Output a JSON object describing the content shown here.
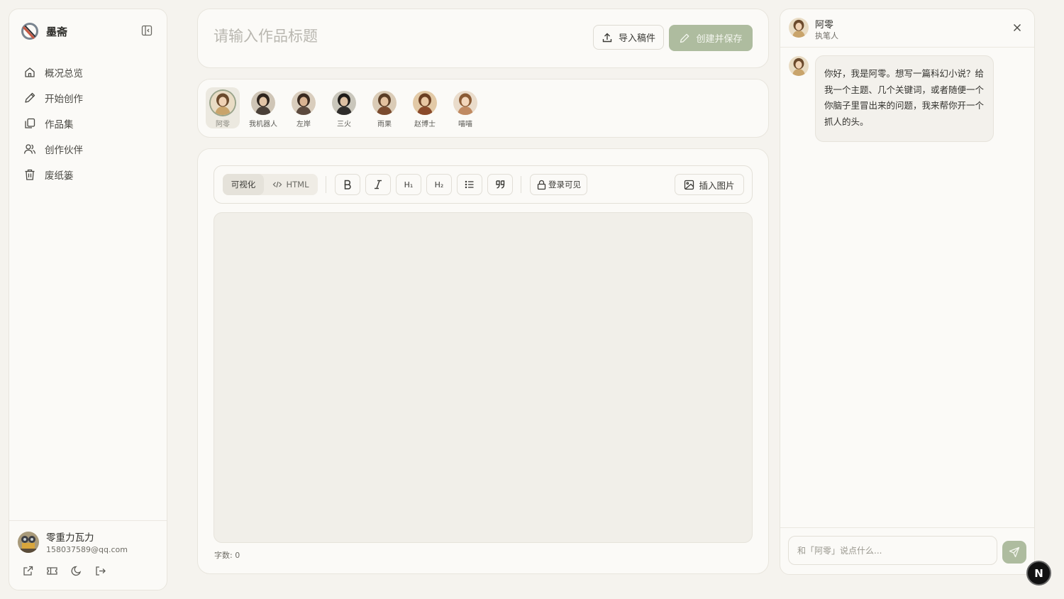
{
  "app": {
    "name": "墨斋",
    "logo_icon": "mozhai-logo-icon",
    "collapse_icon": "sidebar-collapse-icon"
  },
  "nav": [
    {
      "label": "概况总览",
      "icon": "home-icon"
    },
    {
      "label": "开始创作",
      "icon": "pen-icon"
    },
    {
      "label": "作品集",
      "icon": "copy-icon"
    },
    {
      "label": "创作伙伴",
      "icon": "users-icon"
    },
    {
      "label": "废纸篓",
      "icon": "trash-icon"
    }
  ],
  "user": {
    "name": "零重力瓦力",
    "email": "158037589@qq.com"
  },
  "footer_icons": [
    "external-link-icon",
    "ticket-icon",
    "theme-toggle-icon",
    "logout-icon"
  ],
  "title_bar": {
    "placeholder": "请输入作品标题",
    "import_label": "导入稿件",
    "save_label": "创建并保存"
  },
  "partners": {
    "selected": "阿零",
    "items": [
      "阿零",
      "我机器人",
      "左岸",
      "三火",
      "雨果",
      "赵博士",
      "喵喵"
    ]
  },
  "toolbar": {
    "mode_visual": "可视化",
    "mode_html": "HTML",
    "h1": "H₁",
    "h2": "H₂",
    "login_visible": "登录可见",
    "insert_image": "插入图片"
  },
  "editor": {
    "word_count": "字数: 0"
  },
  "chat": {
    "name": "阿零",
    "role": "执笔人",
    "message": "你好，我是阿零。想写一篇科幻小说？给我一个主题、几个关键词，或者随便一个你脑子里冒出来的问题，我来帮你开一个抓人的头。",
    "input_placeholder": "和「阿零」说点什么..."
  },
  "fab_label": "N",
  "colors": {
    "accent": "#aebc9f",
    "background": "#f5f3ee",
    "panel": "#fbfaf7"
  }
}
